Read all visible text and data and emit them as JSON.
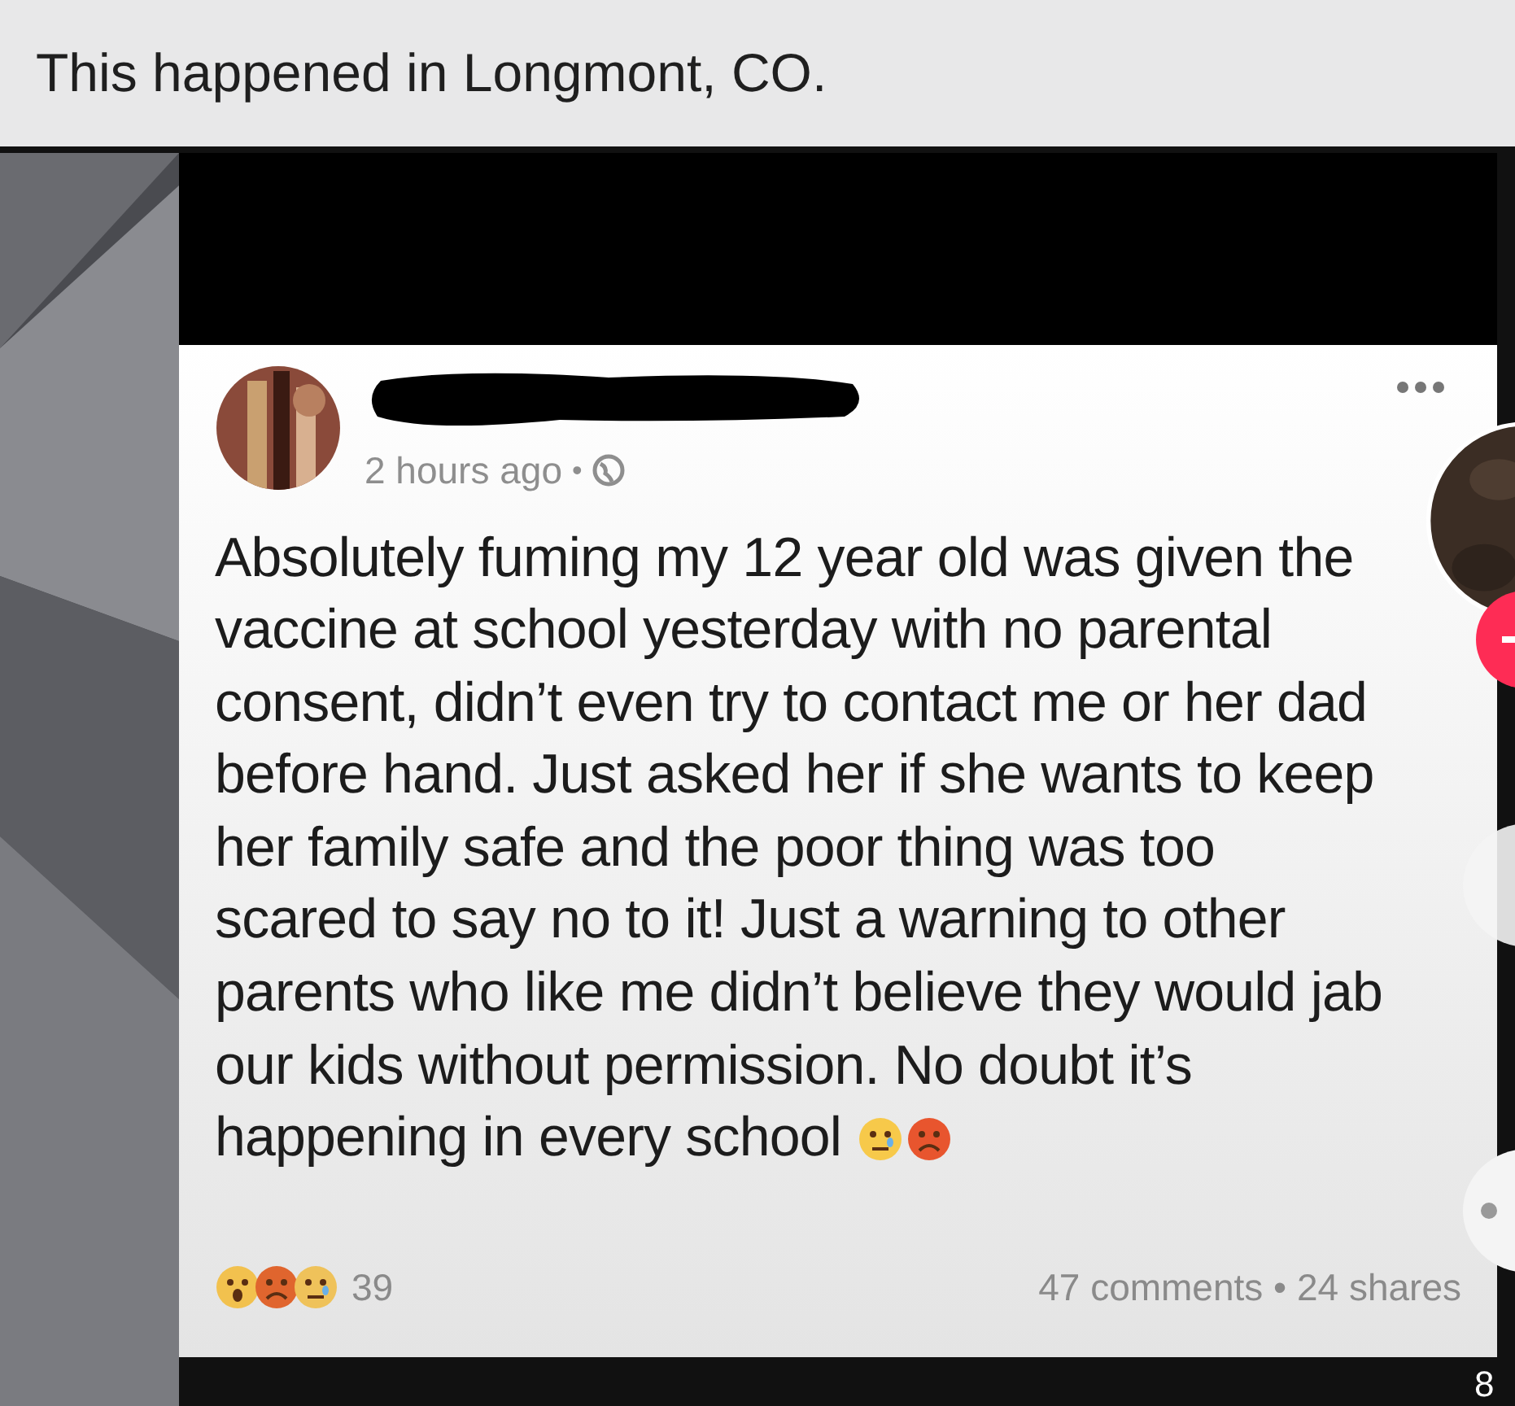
{
  "header": {
    "title": "This happened in Longmont, CO."
  },
  "post": {
    "time": "2 hours ago",
    "separator": "•",
    "lines": [
      "Absolutely fuming my 12 year old was given the",
      "vaccine at school yesterday with no parental",
      "consent, didn’t even try to contact me or her dad",
      "before hand. Just asked her if she wants to keep",
      "her family safe and the poor thing was too",
      "scared to say no to it! Just a warning to other",
      "parents who like me didn’t believe they would jab",
      "our kids without permission. No doubt it’s",
      "happening in every school"
    ],
    "reaction_count": "39",
    "stats": "47 comments • 24 shares"
  },
  "side_overlay": {
    "counter": "8"
  }
}
